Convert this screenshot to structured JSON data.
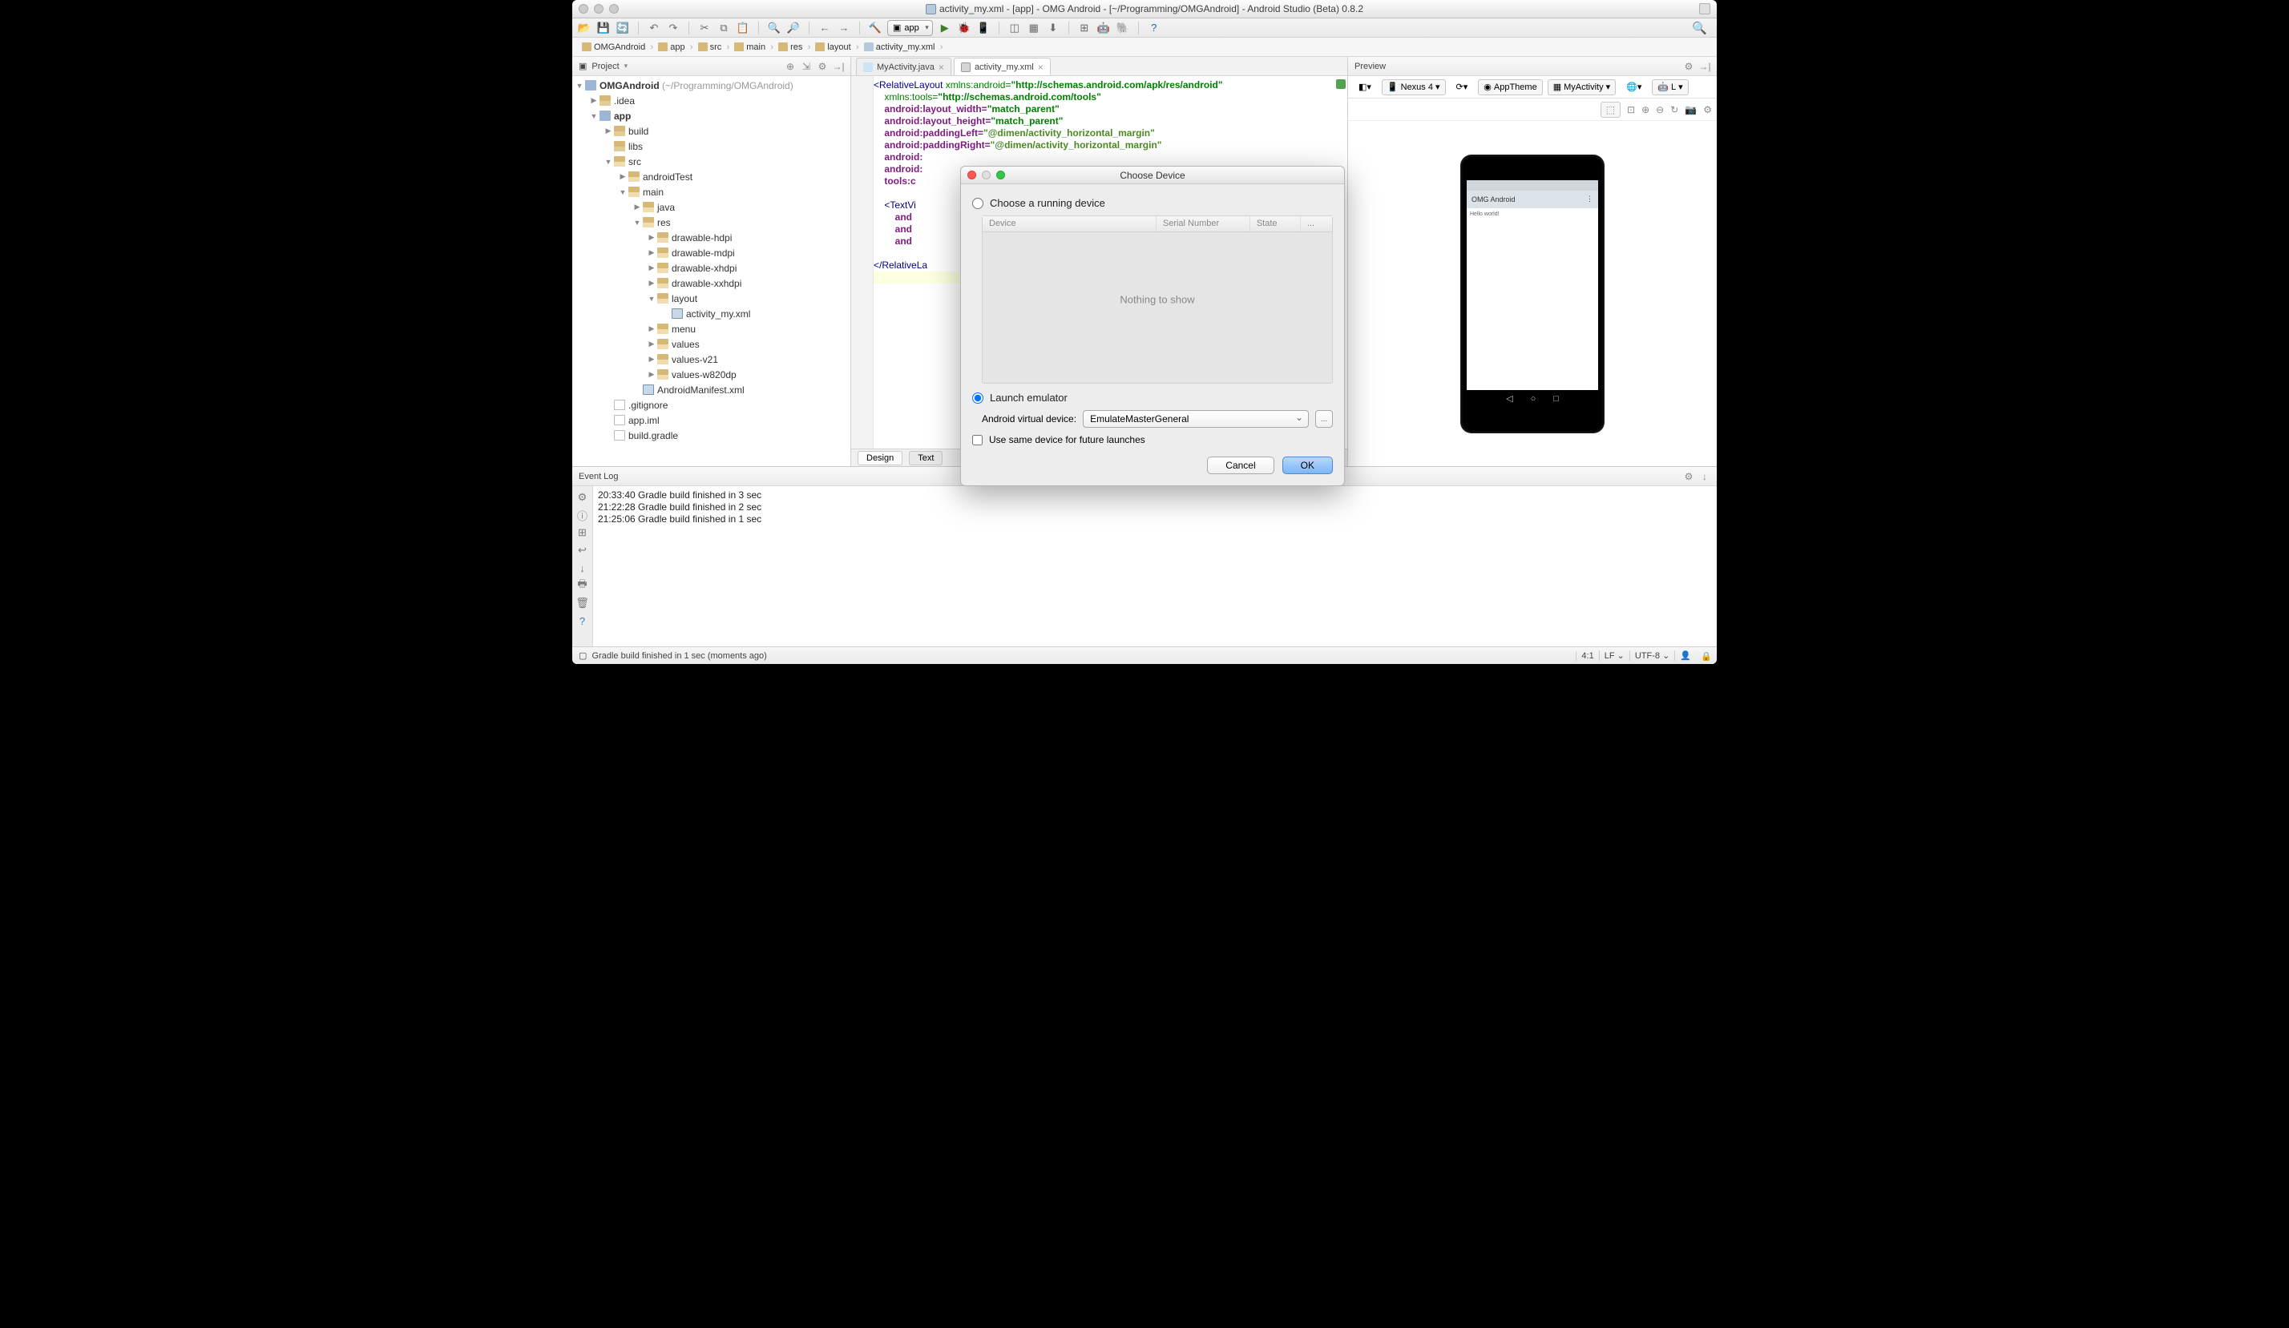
{
  "window": {
    "title": "activity_my.xml - [app] - OMG Android - [~/Programming/OMGAndroid] - Android Studio (Beta) 0.8.2"
  },
  "toolbar": {
    "app_label": "app"
  },
  "breadcrumbs": [
    "OMGAndroid",
    "app",
    "src",
    "main",
    "res",
    "layout",
    "activity_my.xml"
  ],
  "project": {
    "panel_title": "Project",
    "root": "OMGAndroid",
    "root_hint": "(~/Programming/OMGAndroid)",
    "nodes": [
      ".idea",
      "app",
      "build",
      "libs",
      "src",
      "androidTest",
      "main",
      "java",
      "res",
      "drawable-hdpi",
      "drawable-mdpi",
      "drawable-xhdpi",
      "drawable-xxhdpi",
      "layout",
      "activity_my.xml",
      "menu",
      "values",
      "values-v21",
      "values-w820dp",
      "AndroidManifest.xml",
      ".gitignore",
      "app.iml",
      "build.gradle"
    ]
  },
  "tabs": {
    "t1": "MyActivity.java",
    "t2": "activity_my.xml"
  },
  "code": {
    "l1a": "<",
    "l1tag": "RelativeLayout",
    "l1sp": " ",
    "l1attr": "xmlns:android=",
    "l1val": "\"http://schemas.android.com/apk/res/android\"",
    "l2attr": "xmlns:tools=",
    "l2val": "\"http://schemas.android.com/tools\"",
    "l3attr": "android:layout_width=",
    "l3val": "\"match_parent\"",
    "l4attr": "android:layout_height=",
    "l4val": "\"match_parent\"",
    "l5attr": "android:paddingLeft=",
    "l5val": "\"@dimen/activity_horizontal_margin\"",
    "l6attr": "android:paddingRight=",
    "l6val": "\"@dimen/activity_horizontal_margin\"",
    "l7attr": "android:",
    "l8attr": "android:",
    "l9attr": "tools:c",
    "l11a": "<",
    "l11tag": "TextVi",
    "l12": "and",
    "l13": "and",
    "l14": "and",
    "l16a": "</",
    "l16tag": "RelativeLa"
  },
  "editor_tabs": {
    "design": "Design",
    "text": "Text"
  },
  "preview": {
    "panel_title": "Preview",
    "device": "Nexus 4",
    "theme": "AppTheme",
    "activity": "MyActivity",
    "api": "L",
    "app_name": "OMG Android",
    "hello": "Hello world!"
  },
  "eventlog": {
    "panel_title": "Event Log",
    "line1": "20:33:40 Gradle build finished in 3 sec",
    "line2": "21:22:28 Gradle build finished in 2 sec",
    "line3": "21:25:06 Gradle build finished in 1 sec"
  },
  "status": {
    "msg": "Gradle build finished in 1 sec (moments ago)",
    "pos": "4:1",
    "lf": "LF",
    "enc": "UTF-8"
  },
  "dialog": {
    "title": "Choose Device",
    "opt_running": "Choose a running device",
    "col_device": "Device",
    "col_serial": "Serial Number",
    "col_state": "State",
    "col_dots": "...",
    "empty": "Nothing to show",
    "opt_launch": "Launch emulator",
    "avd_label": "Android virtual device:",
    "avd_value": "EmulateMasterGeneral",
    "avd_btn": "...",
    "same_device": "Use same device for future launches",
    "cancel": "Cancel",
    "ok": "OK"
  }
}
